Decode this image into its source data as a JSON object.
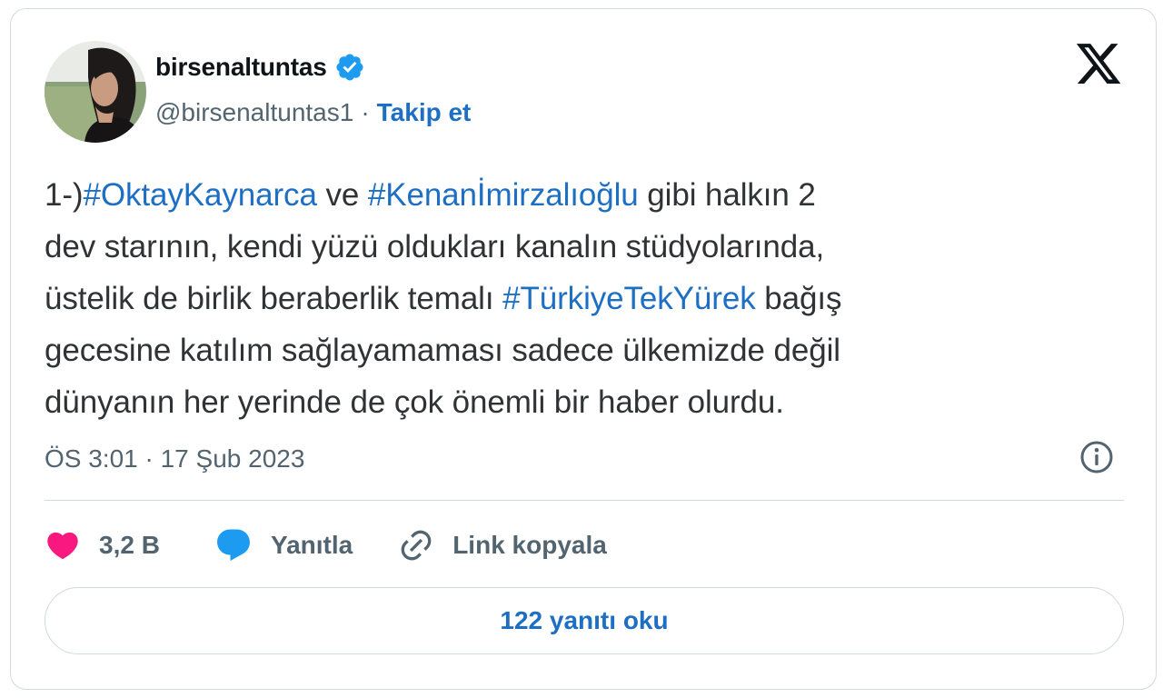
{
  "author": {
    "display_name": "birsenaltuntas",
    "handle": "@birsenaltuntas1",
    "separator": "·",
    "follow_label": "Takip et",
    "verified": true,
    "avatar_icon": "profile-photo"
  },
  "brand": {
    "logo_icon": "x-logo"
  },
  "tweet": {
    "lines": [
      [
        {
          "text": "1-)",
          "tag": false
        },
        {
          "text": "#OktayKaynarca",
          "tag": true
        },
        {
          "text": " ve ",
          "tag": false
        },
        {
          "text": "#Kenanİmirzalıoğlu",
          "tag": true
        },
        {
          "text": " gibi halkın 2",
          "tag": false
        }
      ],
      [
        {
          "text": "dev starının, kendi yüzü oldukları kanalın stüdyolarında,",
          "tag": false
        }
      ],
      [
        {
          "text": "üstelik de birlik beraberlik temalı ",
          "tag": false
        },
        {
          "text": "#TürkiyeTekYürek",
          "tag": true
        },
        {
          "text": " bağış",
          "tag": false
        }
      ],
      [
        {
          "text": "gecesine katılım sağlayamaması sadece ülkemizde değil",
          "tag": false
        }
      ],
      [
        {
          "text": "dünyanın her yerinde de çok önemli bir haber olurdu.",
          "tag": false
        }
      ]
    ],
    "timestamp": "ÖS 3:01 · 17 Şub 2023"
  },
  "actions": {
    "like_count": "3,2 B",
    "reply_label": "Yanıtla",
    "copy_link_label": "Link kopyala"
  },
  "read_replies_label": "122 yanıtı oku",
  "colors": {
    "link": "#1d6fc4",
    "text": "#2f3336",
    "muted": "#536471",
    "like": "#f91880",
    "reply": "#1d9bf0",
    "border": "#cfd9de"
  }
}
